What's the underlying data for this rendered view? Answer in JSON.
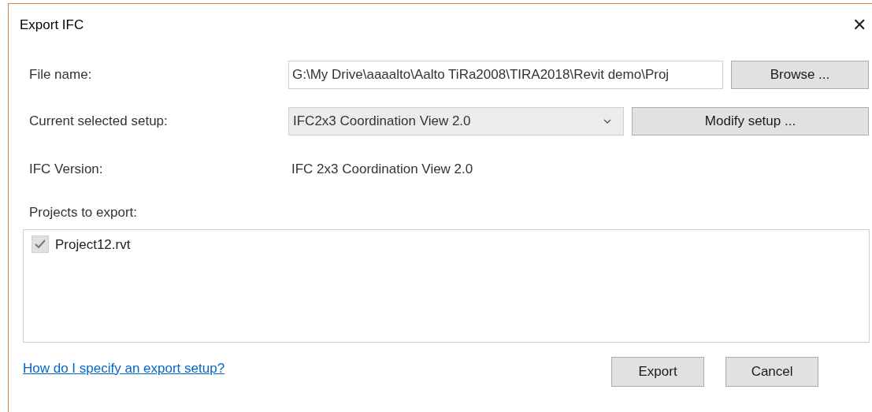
{
  "window": {
    "title": "Export IFC",
    "close": "✕"
  },
  "file_name": {
    "label": "File name:",
    "value": "G:\\My Drive\\aaaalto\\Aalto TiRa2008\\TIRA2018\\Revit demo\\Proj",
    "button": "Browse ..."
  },
  "setup": {
    "label": "Current selected setup:",
    "value": "IFC2x3 Coordination View 2.0",
    "button": "Modify setup ..."
  },
  "ifc_version": {
    "label": "IFC Version:",
    "value": "IFC 2x3 Coordination View 2.0"
  },
  "projects": {
    "label": "Projects to export:",
    "items": [
      {
        "name": "Project12.rvt",
        "checked": true
      }
    ]
  },
  "help_link": "How do I specify an export setup?",
  "buttons": [
    "Export",
    "Cancel"
  ]
}
